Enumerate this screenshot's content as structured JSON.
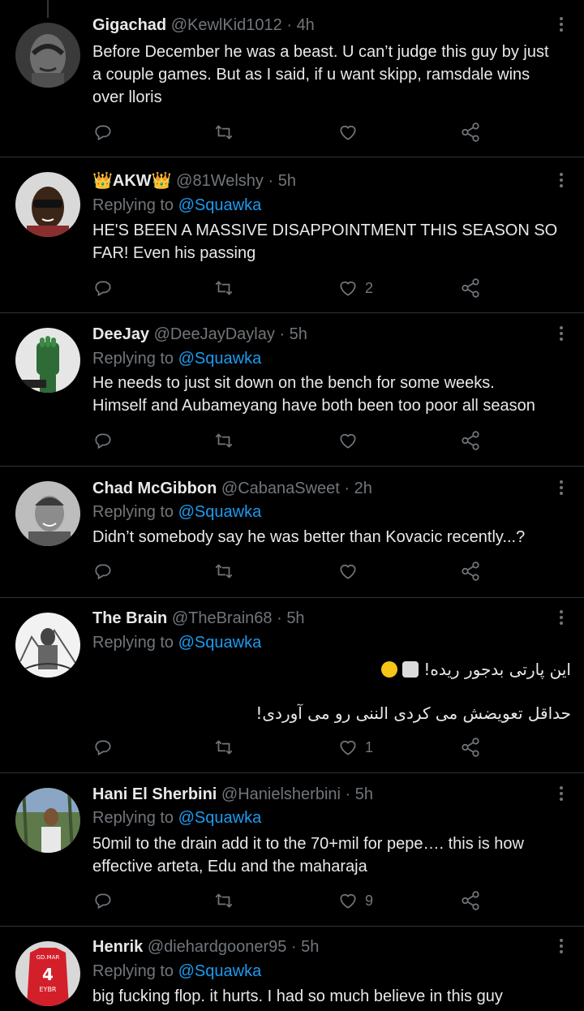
{
  "tweets": [
    {
      "name": "Gigachad",
      "handle": "@KewlKid1012",
      "dot": "·",
      "time": "4h",
      "replying_label": "",
      "replying_to": "",
      "lines": [
        "Before December he was a beast. U can’t judge this guy by just",
        "a couple games. But as I said, if u want skipp, ramsdale wins",
        "over lloris"
      ],
      "likes": ""
    },
    {
      "name": "AKW",
      "name_prefix": "👑",
      "name_suffix": "👑",
      "handle": "@81Welshy",
      "dot": "·",
      "time": "5h",
      "replying_label": "Replying to",
      "replying_to": "@Squawka",
      "lines": [
        "HE'S BEEN A MASSIVE DISAPPOINTMENT THIS SEASON SO",
        "FAR! Even his passing"
      ],
      "likes": "2"
    },
    {
      "name": "DeeJay",
      "handle": "@DeeJayDaylay",
      "dot": "·",
      "time": "5h",
      "replying_label": "Replying to",
      "replying_to": "@Squawka",
      "lines": [
        "He needs to just sit down on the bench for some weeks.",
        "Himself and Aubameyang have both been too poor all season"
      ],
      "likes": ""
    },
    {
      "name": "Chad McGibbon",
      "handle": "@CabanaSweet",
      "dot": "·",
      "time": "2h",
      "replying_label": "Replying to",
      "replying_to": "@Squawka",
      "lines": [
        "Didn’t somebody say he was better than Kovacic recently...?"
      ],
      "likes": ""
    },
    {
      "name": "The Brain",
      "handle": "@TheBrain68",
      "dot": "·",
      "time": "5h",
      "replying_label": "Replying to",
      "replying_to": "@Squawka",
      "lines": [
        "این پارتی بدجور ریده!",
        "حداقل تعویضش می کردی الننی رو می آوردی!"
      ],
      "likes": "1"
    },
    {
      "name": "Hani El Sherbini",
      "handle": "@Hanielsherbini",
      "dot": "·",
      "time": "5h",
      "replying_label": "Replying to",
      "replying_to": "@Squawka",
      "lines": [
        "50mil to the drain add it to the 70+mil for pepe…. this is how",
        "effective arteta, Edu and the maharaja"
      ],
      "likes": "9"
    },
    {
      "name": "Henrik",
      "handle": "@diehardgooner95",
      "dot": "·",
      "time": "5h",
      "replying_label": "Replying to",
      "replying_to": "@Squawka",
      "lines": [
        "big fucking flop. it hurts. I had so much believe in this guy"
      ],
      "likes": ""
    }
  ],
  "icons": {
    "reply": "reply-icon",
    "retweet": "retweet-icon",
    "like": "heart-icon",
    "share": "share-icon",
    "more": "more-icon"
  },
  "colors": {
    "background": "#000000",
    "text": "#e7e9ea",
    "muted": "#71767b",
    "link": "#1d9bf0",
    "divider": "#2f3336"
  },
  "jersey": {
    "top": "GD.MAR",
    "number": "4",
    "bottom": "EYBR"
  }
}
